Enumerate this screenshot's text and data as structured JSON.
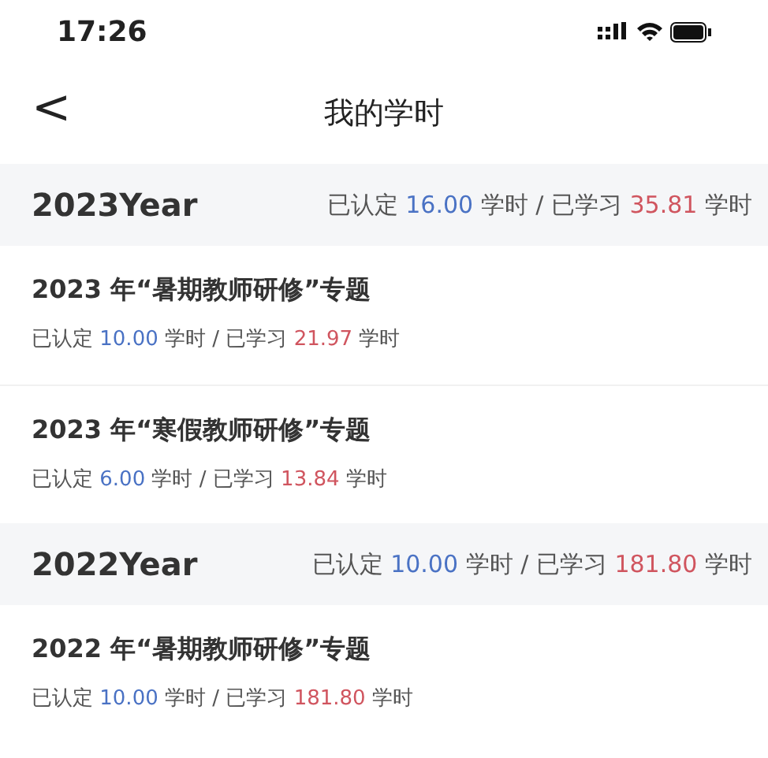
{
  "status_bar": {
    "time": "17:26"
  },
  "nav": {
    "back": "<",
    "title": "我的学时"
  },
  "years": [
    {
      "title": "2023Year",
      "summary": {
        "certified_label": "已认定",
        "certified": "16.00",
        "certified_unit": "学时",
        "separator": "/",
        "studied_label": "已学习",
        "studied": "35.81",
        "studied_unit": "学时"
      },
      "items": [
        {
          "title": "2023 年“暑期教师研修”专题",
          "summary": {
            "certified_label": "已认定",
            "certified": "10.00",
            "certified_unit": "学时",
            "separator": "/",
            "studied_label": "已学习",
            "studied": "21.97",
            "studied_unit": "学时"
          }
        },
        {
          "title": "2023 年“寒假教师研修”专题",
          "summary": {
            "certified_label": "已认定",
            "certified": "6.00",
            "certified_unit": "学时",
            "separator": "/",
            "studied_label": "已学习",
            "studied": "13.84",
            "studied_unit": "学时"
          }
        }
      ]
    },
    {
      "title": "2022Year",
      "summary": {
        "certified_label": "已认定",
        "certified": "10.00",
        "certified_unit": "学时",
        "separator": "/",
        "studied_label": "已学习",
        "studied": "181.80",
        "studied_unit": "学时"
      },
      "items": [
        {
          "title": "2022 年“暑期教师研修”专题",
          "summary": {
            "certified_label": "已认定",
            "certified": "10.00",
            "certified_unit": "学时",
            "separator": "/",
            "studied_label": "已学习",
            "studied": "181.80",
            "studied_unit": "学时"
          }
        }
      ]
    }
  ]
}
